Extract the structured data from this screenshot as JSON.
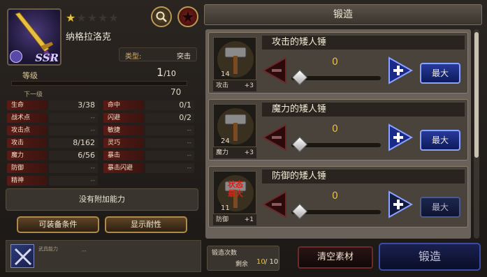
{
  "character": {
    "name": "纳格拉洛克",
    "rarity": "SSR",
    "stars": [
      true,
      false,
      false,
      false,
      false
    ],
    "type_label": "类型:",
    "type_value": "突击"
  },
  "level": {
    "label": "等级",
    "current": "1",
    "max": "/10",
    "progress": 0,
    "next_label": "下一级",
    "next_value": "70"
  },
  "stats": [
    {
      "label": "生命",
      "value": "3/38"
    },
    {
      "label": "命中",
      "value": "0/1"
    },
    {
      "label": "战术点",
      "value": "--"
    },
    {
      "label": "闪避",
      "value": "0/2"
    },
    {
      "label": "攻击点",
      "value": "--"
    },
    {
      "label": "敏捷",
      "value": "--"
    },
    {
      "label": "攻击",
      "value": "8/162"
    },
    {
      "label": "灵巧",
      "value": "--"
    },
    {
      "label": "魔力",
      "value": "6/56"
    },
    {
      "label": "暴击",
      "value": "--"
    },
    {
      "label": "防御",
      "value": "--"
    },
    {
      "label": "暴击闪避",
      "value": "--"
    },
    {
      "label": "精神",
      "value": "--"
    }
  ],
  "no_ability": "没有附加能力",
  "buttons": {
    "equip_conditions": "可装备条件",
    "show_resistance": "显示耐性"
  },
  "weapon_ability": {
    "label": "武具能力",
    "value": "--"
  },
  "forge": {
    "header": "锻造",
    "items": [
      {
        "name": "攻击的矮人锤",
        "count": "14",
        "stat": "攻击",
        "bonus": "+3",
        "value": "0",
        "max_label": "最大",
        "maxed_text": ""
      },
      {
        "name": "魔力的矮人锤",
        "count": "24",
        "stat": "魔力",
        "bonus": "+3",
        "value": "0",
        "max_label": "最大",
        "maxed_text": ""
      },
      {
        "name": "防御的矮人锤",
        "count": "11",
        "stat": "防御",
        "bonus": "+1",
        "value": "0",
        "max_label": "最大",
        "maxed_text": "状态\n最大"
      }
    ],
    "count_label": "锻造次数",
    "remain_label": "剩余",
    "remain_value": "10",
    "remain_max": "/ 10",
    "clear_label": "清空素材",
    "forge_label": "锻造"
  },
  "colors": {
    "star_on": "#e8c040",
    "accent_blue": "#263a9a",
    "stat_label_bg": "#5a1a14"
  }
}
